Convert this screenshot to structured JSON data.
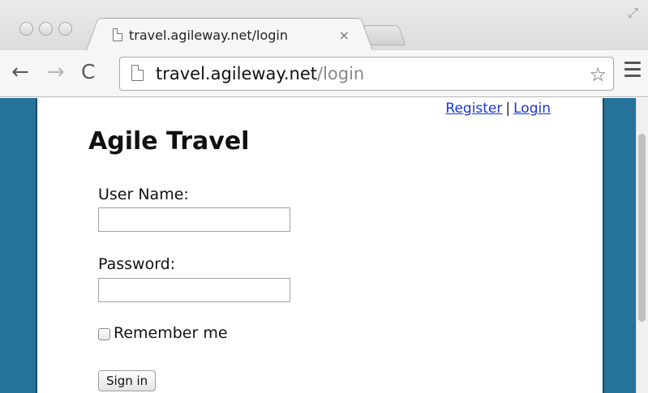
{
  "browser": {
    "tab_title": "travel.agileway.net/login",
    "tab_close_glyph": "×",
    "url_host": "travel.agileway.net",
    "url_path": "/login",
    "back_glyph": "←",
    "forward_glyph": "→",
    "reload_glyph": "C",
    "star_glyph": "☆",
    "fullscreen_glyph": "⤢",
    "icons": [
      "back-icon",
      "forward-icon",
      "reload-icon",
      "page-icon",
      "bookmark-star-icon",
      "menu-icon",
      "fullscreen-icon",
      "close-icon"
    ]
  },
  "page": {
    "header_links": {
      "register": "Register",
      "separator": "|",
      "login": "Login"
    },
    "title": "Agile Travel",
    "form": {
      "username_label": "User Name:",
      "username_value": "",
      "password_label": "Password:",
      "password_value": "",
      "remember_label": "Remember me",
      "remember_checked": false,
      "submit_label": "Sign in"
    }
  },
  "colors": {
    "page_background": "#25729a",
    "link": "#1a35d8"
  }
}
